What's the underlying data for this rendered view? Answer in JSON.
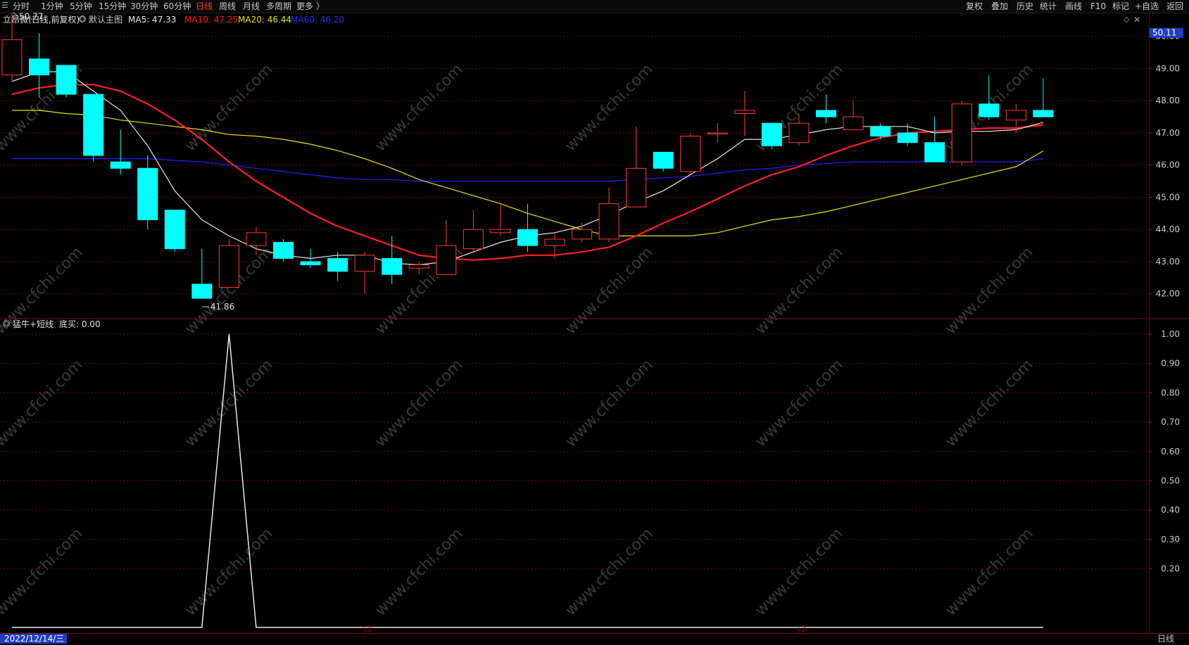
{
  "toolbar": {
    "tabs": [
      {
        "label": "分时"
      },
      {
        "label": "1分钟"
      },
      {
        "label": "5分钟"
      },
      {
        "label": "15分钟"
      },
      {
        "label": "30分钟"
      },
      {
        "label": "60分钟"
      },
      {
        "label": "日线",
        "active": true
      },
      {
        "label": "周线"
      },
      {
        "label": "月线"
      },
      {
        "label": "多周期"
      },
      {
        "label": "更多 〉"
      }
    ],
    "right_tools": [
      "复权",
      "叠加",
      "历史",
      "统计",
      "画线",
      "F10",
      "标记",
      "+自选",
      "返回"
    ]
  },
  "info": {
    "stock": "立昂微(日线,前复权)",
    "main_chart": "默认主图",
    "ma5": "MA5: 47.33",
    "ma10": "MA10: 47.25",
    "ma20": "MA20: 46.44",
    "ma60": "MA60: 46.20"
  },
  "indicator": {
    "name": "猛牛+短线",
    "value": "底买: 0.00"
  },
  "colors": {
    "up": "#ff3b3b",
    "down": "#00ffff",
    "ma5": "#e8e8e8",
    "ma10": "#ff2020",
    "ma20": "#e6e600",
    "ma60": "#2020ff",
    "grid": "#7a0000",
    "badge": "#1f3fbf"
  },
  "axis": {
    "price_ticks": [
      "50.00",
      "49.00",
      "48.00",
      "47.00",
      "46.00",
      "45.00",
      "44.00",
      "43.00",
      "42.00"
    ],
    "current_price": "50.11",
    "ind_ticks": [
      "1.00",
      "0.90",
      "0.80",
      "0.70",
      "0.60",
      "0.50",
      "0.40",
      "0.30",
      "0.20"
    ],
    "high_label": "50.77",
    "low_label": "41.86",
    "month_marks": [
      "1",
      "2"
    ]
  },
  "footer": {
    "date": "2022/12/14/三",
    "period": "日线"
  },
  "watermark": "www.cfchi.com",
  "chart_data": {
    "type": "candlestick",
    "ylim": [
      41.6,
      50.3
    ],
    "candles": [
      [
        48.8,
        49.9,
        48.6,
        50.77
      ],
      [
        49.3,
        48.8,
        48.1,
        50.1
      ],
      [
        49.1,
        48.2,
        48.1,
        49.1
      ],
      [
        48.2,
        46.3,
        46.1,
        48.2
      ],
      [
        46.1,
        45.9,
        45.7,
        47.1
      ],
      [
        45.9,
        44.3,
        44.0,
        46.3
      ],
      [
        44.6,
        43.4,
        43.3,
        44.6
      ],
      [
        42.3,
        41.86,
        41.86,
        43.4
      ],
      [
        42.2,
        43.5,
        42.2,
        43.7
      ],
      [
        43.5,
        43.9,
        43.2,
        44.1
      ],
      [
        43.6,
        43.1,
        43.0,
        43.7
      ],
      [
        43.0,
        42.9,
        42.8,
        43.4
      ],
      [
        43.1,
        42.7,
        42.4,
        43.3
      ],
      [
        42.7,
        43.2,
        42.0,
        43.3
      ],
      [
        43.1,
        42.6,
        42.3,
        43.8
      ],
      [
        42.8,
        42.9,
        42.6,
        43.0
      ],
      [
        42.6,
        43.5,
        42.6,
        44.3
      ],
      [
        43.4,
        44.0,
        43.3,
        44.6
      ],
      [
        43.9,
        44.0,
        43.8,
        44.8
      ],
      [
        44.0,
        43.5,
        43.3,
        44.8
      ],
      [
        43.5,
        43.7,
        43.1,
        43.9
      ],
      [
        43.7,
        44.0,
        43.6,
        44.2
      ],
      [
        43.7,
        44.8,
        43.6,
        45.3
      ],
      [
        44.7,
        45.9,
        44.7,
        47.2
      ],
      [
        46.4,
        45.9,
        45.8,
        46.4
      ],
      [
        45.8,
        46.9,
        45.7,
        47.0
      ],
      [
        47.0,
        47.0,
        46.7,
        47.3
      ],
      [
        47.6,
        47.7,
        46.9,
        48.3
      ],
      [
        47.3,
        46.6,
        46.5,
        47.3
      ],
      [
        46.7,
        47.3,
        46.6,
        47.6
      ],
      [
        47.7,
        47.5,
        47.3,
        48.2
      ],
      [
        47.1,
        47.5,
        47.1,
        48.0
      ],
      [
        47.2,
        46.9,
        46.8,
        47.3
      ],
      [
        47.0,
        46.7,
        46.6,
        47.3
      ],
      [
        46.7,
        46.1,
        46.1,
        47.5
      ],
      [
        46.1,
        47.9,
        46.0,
        48.0
      ],
      [
        47.9,
        47.5,
        47.4,
        48.8
      ],
      [
        47.4,
        47.7,
        47.0,
        47.9
      ],
      [
        47.7,
        47.5,
        47.5,
        48.7
      ]
    ],
    "ma5": [
      48.6,
      48.9,
      48.9,
      48.3,
      47.7,
      46.6,
      45.2,
      44.3,
      43.8,
      43.4,
      43.2,
      43.1,
      43.2,
      43.2,
      42.95,
      42.9,
      43.0,
      43.3,
      43.6,
      43.8,
      43.9,
      44.1,
      44.45,
      44.85,
      45.2,
      45.7,
      46.2,
      46.8,
      46.8,
      46.95,
      47.1,
      47.2,
      47.2,
      47.2,
      47.0,
      47.05,
      47.05,
      47.1,
      47.33
    ],
    "ma10": [
      48.2,
      48.4,
      48.5,
      48.5,
      48.3,
      47.9,
      47.4,
      46.8,
      46.1,
      45.5,
      45.0,
      44.5,
      44.1,
      43.8,
      43.5,
      43.2,
      43.1,
      43.05,
      43.1,
      43.2,
      43.2,
      43.3,
      43.45,
      43.8,
      44.2,
      44.55,
      44.95,
      45.35,
      45.7,
      45.95,
      46.3,
      46.6,
      46.85,
      47.0,
      47.05,
      47.1,
      47.15,
      47.15,
      47.25
    ],
    "ma20": [
      47.7,
      47.7,
      47.6,
      47.55,
      47.4,
      47.3,
      47.2,
      47.1,
      46.95,
      46.9,
      46.8,
      46.65,
      46.45,
      46.2,
      45.9,
      45.55,
      45.3,
      45.05,
      44.8,
      44.5,
      44.25,
      44.0,
      43.8,
      43.8,
      43.8,
      43.8,
      43.9,
      44.1,
      44.3,
      44.4,
      44.55,
      44.75,
      44.95,
      45.15,
      45.35,
      45.55,
      45.75,
      45.95,
      46.44
    ],
    "ma60": [
      46.2,
      46.2,
      46.2,
      46.2,
      46.2,
      46.2,
      46.15,
      46.1,
      46.0,
      45.9,
      45.8,
      45.7,
      45.6,
      45.55,
      45.55,
      45.5,
      45.5,
      45.5,
      45.5,
      45.5,
      45.5,
      45.5,
      45.5,
      45.55,
      45.6,
      45.65,
      45.75,
      45.85,
      45.9,
      46.0,
      46.05,
      46.1,
      46.1,
      46.1,
      46.1,
      46.1,
      46.1,
      46.1,
      46.2
    ],
    "indicator_values": [
      0,
      0,
      0,
      0,
      0,
      0,
      0,
      0,
      1,
      0,
      0,
      0,
      0,
      0,
      0,
      0,
      0,
      0,
      0,
      0,
      0,
      0,
      0,
      0,
      0,
      0,
      0,
      0,
      0,
      0,
      0,
      0,
      0,
      0,
      0,
      0,
      0,
      0,
      0
    ],
    "indicator_ylim": [
      0.0,
      1.0
    ]
  }
}
